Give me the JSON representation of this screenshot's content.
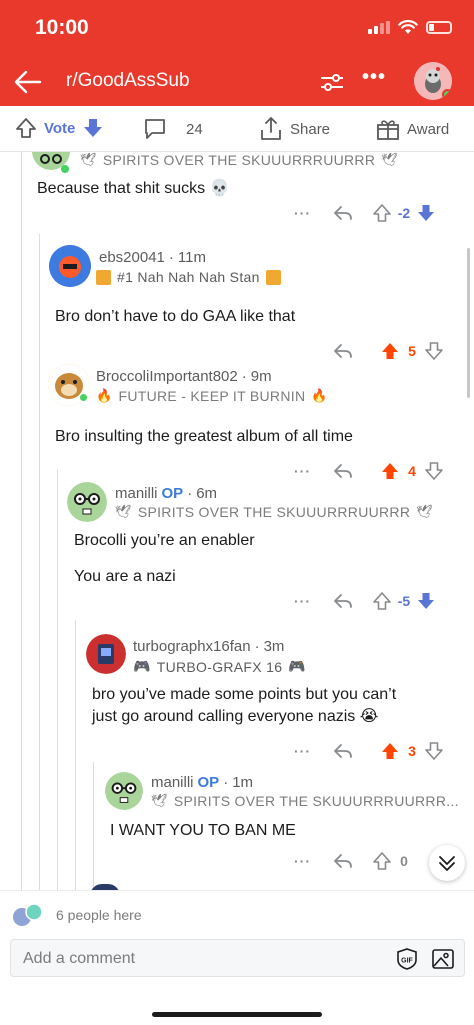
{
  "status_bar": {
    "time": "10:00"
  },
  "nav": {
    "title": "r/GoodAssSub"
  },
  "actions": {
    "vote_label": "Vote",
    "comment_count": "24",
    "share_label": "Share",
    "award_label": "Award"
  },
  "colors": {
    "brand_red": "#e8392c",
    "upvote": "#ff4500",
    "downvote": "#5a75d6",
    "op": "#3d7bd8"
  },
  "comments": [
    {
      "flair": "SPIRITS OVER THE SKUUURRRUURRR",
      "flair_icon": "dove-icon",
      "body": "Because that shit sucks 💀",
      "score": "-2",
      "vote_state": "down"
    },
    {
      "username": "ebs20041",
      "age": "11m",
      "flair": "#1 Nah Nah Nah Stan",
      "flair_icon": "album-cover-icon",
      "body": "Bro don’t have to do GAA like that",
      "score": "5",
      "vote_state": "up"
    },
    {
      "username": "BroccoliImportant802",
      "age": "9m",
      "flair": "FUTURE - KEEP IT BURNIN",
      "flair_icon": "fire-icon",
      "body": "Bro insulting the greatest album of all time",
      "score": "4",
      "vote_state": "up"
    },
    {
      "username": "manilli",
      "op_label": "OP",
      "age": "6m",
      "flair": "SPIRITS OVER THE SKUUURRRUURRR",
      "flair_icon": "dove-icon",
      "body_line1": "Brocolli you’re an enabler",
      "body_line2": "You are a nazi",
      "score": "-5",
      "vote_state": "down"
    },
    {
      "username": "turbographx16fan",
      "age": "3m",
      "flair": "TURBO-GRAFX 16",
      "flair_icon": "gamepad-icon",
      "body_line1": "bro you’ve made some points but you can’t",
      "body_line2": "just go around calling everyone nazis 😭",
      "score": "3",
      "vote_state": "up"
    },
    {
      "username": "manilli",
      "op_label": "OP",
      "age": "1m",
      "flair": "SPIRITS OVER THE SKUUURRRUURRR...",
      "flair_icon": "dove-icon",
      "body": "I WANT YOU TO BAN ME",
      "score": "0",
      "vote_state": "none"
    }
  ],
  "presence": {
    "text": "6 people here"
  },
  "composer": {
    "placeholder": "Add a comment"
  }
}
